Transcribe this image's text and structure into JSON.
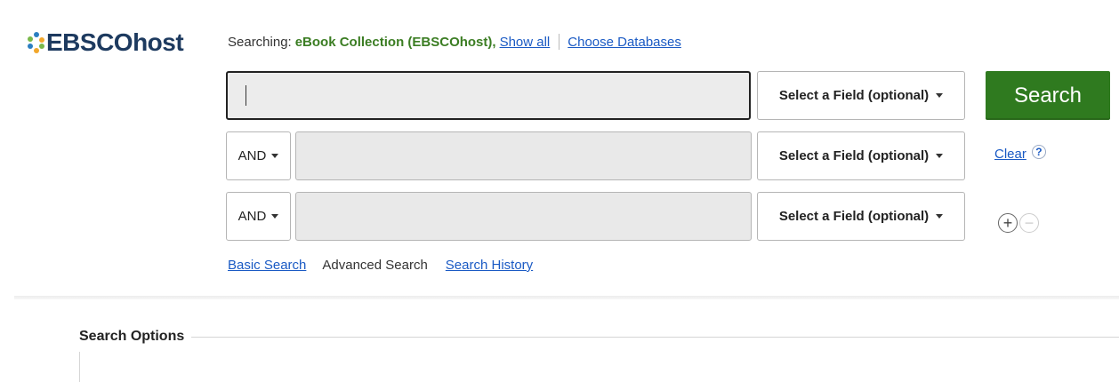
{
  "logo": {
    "text": "EBSCOhost",
    "dot_colors": [
      "#2b7ec1",
      "#79b84a",
      "#f2a72b",
      "#2b7ec1",
      "#79b84a",
      "#f2a72b"
    ]
  },
  "searching": {
    "prefix": "Searching:",
    "database": "eBook Collection (EBSCOhost),",
    "show_all": "Show all",
    "choose_databases": "Choose Databases"
  },
  "rows": [
    {
      "term_value": "",
      "field_label": "Select a Field (optional)"
    },
    {
      "bool": "AND",
      "term_value": "",
      "field_label": "Select a Field (optional)"
    },
    {
      "bool": "AND",
      "term_value": "",
      "field_label": "Select a Field (optional)"
    }
  ],
  "search_button": "Search",
  "clear_link": "Clear",
  "help_symbol": "?",
  "add_row_symbol": "+",
  "remove_row_symbol": "−",
  "nav": {
    "basic": "Basic Search",
    "advanced": "Advanced Search",
    "history": "Search History"
  },
  "search_options": {
    "legend": "Search Options"
  },
  "colors": {
    "search_button": "#2f7a1f",
    "database_name": "#3b7d23",
    "link": "#1a5ac4",
    "logo_text": "#1d3a5f"
  }
}
